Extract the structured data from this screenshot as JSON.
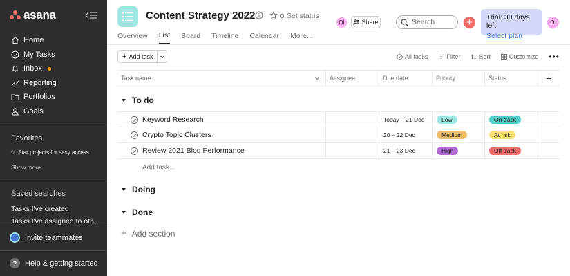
{
  "app": {
    "logo_text": "asana"
  },
  "sidebar": {
    "nav": [
      {
        "label": "Home",
        "icon": "home-icon"
      },
      {
        "label": "My Tasks",
        "icon": "check-circle-icon"
      },
      {
        "label": "Inbox",
        "icon": "bell-icon"
      },
      {
        "label": "Reporting",
        "icon": "trend-icon"
      },
      {
        "label": "Portfolios",
        "icon": "folder-icon"
      },
      {
        "label": "Goals",
        "icon": "person-icon"
      }
    ],
    "favorites_title": "Favorites",
    "favorites_hint": "Star projects for easy access",
    "show_more": "Show more",
    "saved_title": "Saved searches",
    "saved": [
      "Tasks I've created",
      "Tasks I've assigned to oth..."
    ],
    "invite": "Invite teammates",
    "help": "Help & getting started",
    "help_glyph": "?"
  },
  "header": {
    "title": "Content Strategy 2022",
    "set_status": "Set status",
    "avatar_initials": "OI",
    "share": "Share",
    "search_placeholder": "Search",
    "trial_text": "Trial: 30 days left",
    "trial_link": "Select plan",
    "tabs": [
      "Overview",
      "List",
      "Board",
      "Timeline",
      "Calendar",
      "More..."
    ],
    "active_tab": "List"
  },
  "toolbar": {
    "add_task": "Add task",
    "all_tasks": "All tasks",
    "filter": "Filter",
    "sort": "Sort",
    "customize": "Customize"
  },
  "columns": {
    "task_name": "Task name",
    "assignee": "Assignee",
    "due_date": "Due date",
    "priority": "Priority",
    "status": "Status"
  },
  "sections": [
    {
      "title": "To do"
    },
    {
      "title": "Doing"
    },
    {
      "title": "Done"
    }
  ],
  "tasks": [
    {
      "name": "Keyword Research",
      "due": "Today – 21 Dec",
      "priority": "Low",
      "priority_color": "#9ee7e3",
      "status": "On track",
      "status_color": "#4ecbc4"
    },
    {
      "name": "Crypto Topic Clusters",
      "due": "20 – 22 Dec",
      "priority": "Medium",
      "priority_color": "#f1bd6c",
      "status": "At risk",
      "status_color": "#f8df72"
    },
    {
      "name": "Review 2021 Blog Performance",
      "due": "21 – 23 Dec",
      "priority": "High",
      "priority_color": "#b36bd4",
      "status": "Off track",
      "status_color": "#f06a6a"
    }
  ],
  "add_task_inline": "Add task...",
  "add_section": "Add section"
}
